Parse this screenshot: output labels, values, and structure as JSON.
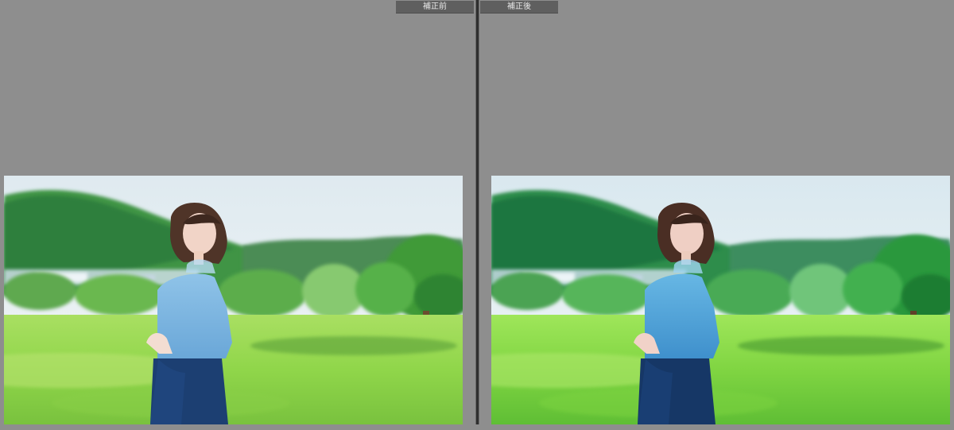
{
  "comparison": {
    "before_label": "補正前",
    "after_label": "補正後"
  },
  "colors": {
    "workspace_background": "#8e8e8e",
    "label_background": "#5f5f5f",
    "divider": "#2f2f2f"
  },
  "icons": {
    "divider_handle": "split-divider"
  }
}
